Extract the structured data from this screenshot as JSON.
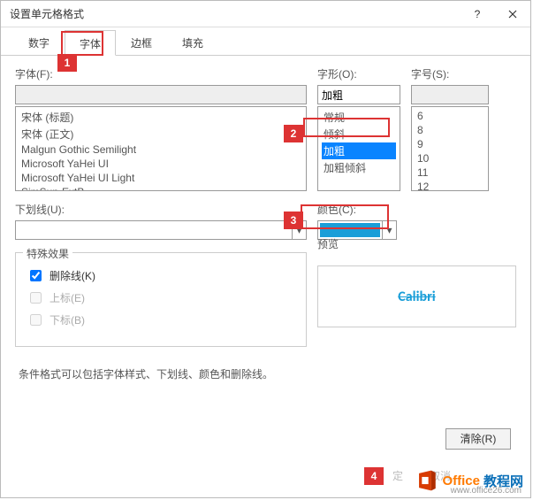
{
  "title": "设置单元格格式",
  "tabs": {
    "number": "数字",
    "font": "字体",
    "border": "边框",
    "fill": "填充"
  },
  "labels": {
    "font": "字体(F):",
    "style": "字形(O):",
    "size": "字号(S):",
    "underline": "下划线(U):",
    "color": "颜色(C):",
    "effects": "特殊效果",
    "strike": "删除线(K)",
    "super": "上标(E)",
    "sub": "下标(B)",
    "preview": "预览",
    "note": "条件格式可以包括字体样式、下划线、颜色和删除线。",
    "clear": "清除(R)",
    "ok": "定",
    "cancel": "取消"
  },
  "values": {
    "font_input": "",
    "style_input": "加粗",
    "size_input": "",
    "underline_input": "",
    "preview_text": "Calibri"
  },
  "font_list": [
    "宋体 (标题)",
    "宋体 (正文)",
    "Malgun Gothic Semilight",
    "Microsoft YaHei UI",
    "Microsoft YaHei UI Light",
    "SimSun-ExtB"
  ],
  "style_list": [
    "常规",
    "倾斜",
    "加粗",
    "加粗倾斜"
  ],
  "style_selected_index": 2,
  "size_list": [
    "6",
    "8",
    "9",
    "10",
    "11",
    "12"
  ],
  "callouts": {
    "c1": "1",
    "c2": "2",
    "c3": "3",
    "c4": "4"
  },
  "brand": {
    "t1": "Office",
    "t2": "教程网",
    "url": "www.office26.com"
  },
  "color_hex": "#1a9ed8"
}
